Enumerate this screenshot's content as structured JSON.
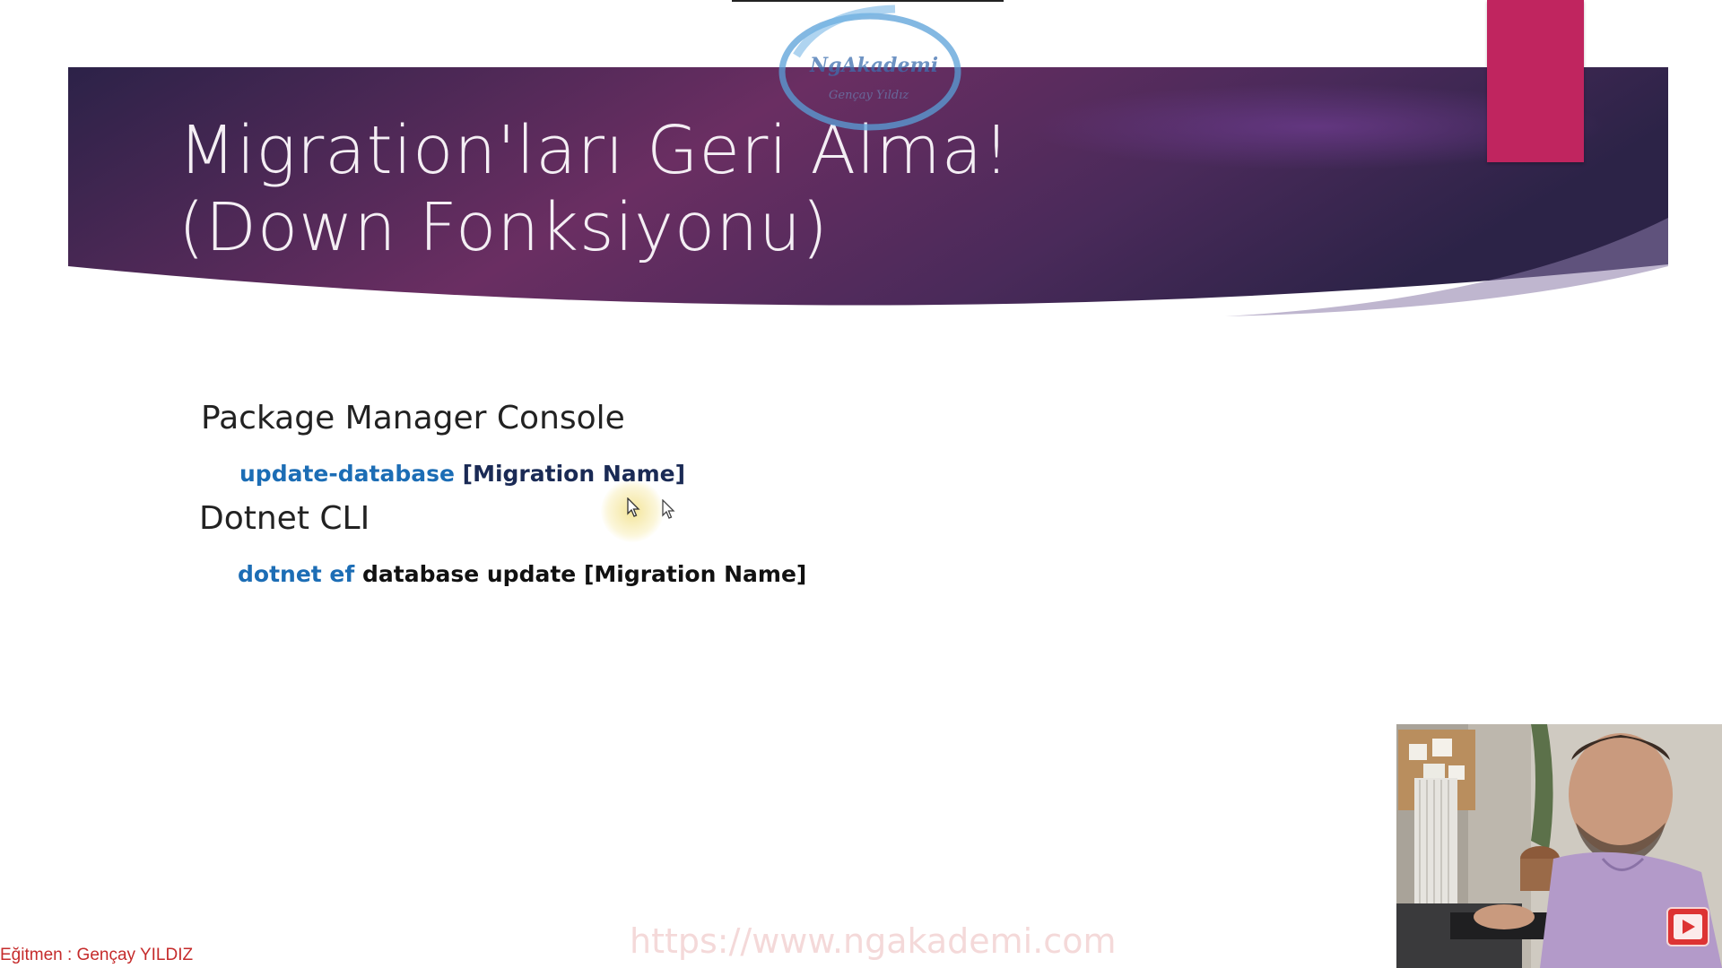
{
  "slide": {
    "title_line1": "Migration'ları Geri Alma!",
    "title_line2": "(Down Fonksiyonu)",
    "sections": [
      {
        "heading": "Package Manager Console",
        "command_parts": [
          "update-database",
          "[Migration Name]"
        ]
      },
      {
        "heading": "Dotnet CLI",
        "command_parts": [
          "dotnet ef",
          "database update [Migration Name]"
        ]
      }
    ]
  },
  "overlay": {
    "watermark_url": "https://www.ngakademi.com",
    "instructor_label": "Eğitmen : Gençay YILDIZ"
  },
  "colors": {
    "banner_dark": "#2e1f4a",
    "banner_mid": "#6a2f63",
    "accent_pink": "#c0255f",
    "command_blue": "#1c6db5",
    "command_navy": "#1a2a55",
    "instructor_red": "#c52b2b"
  },
  "icons": {
    "logo": "ngakademi-logo",
    "cursor": "mouse-pointer-icon",
    "play": "youtube-play-icon"
  }
}
